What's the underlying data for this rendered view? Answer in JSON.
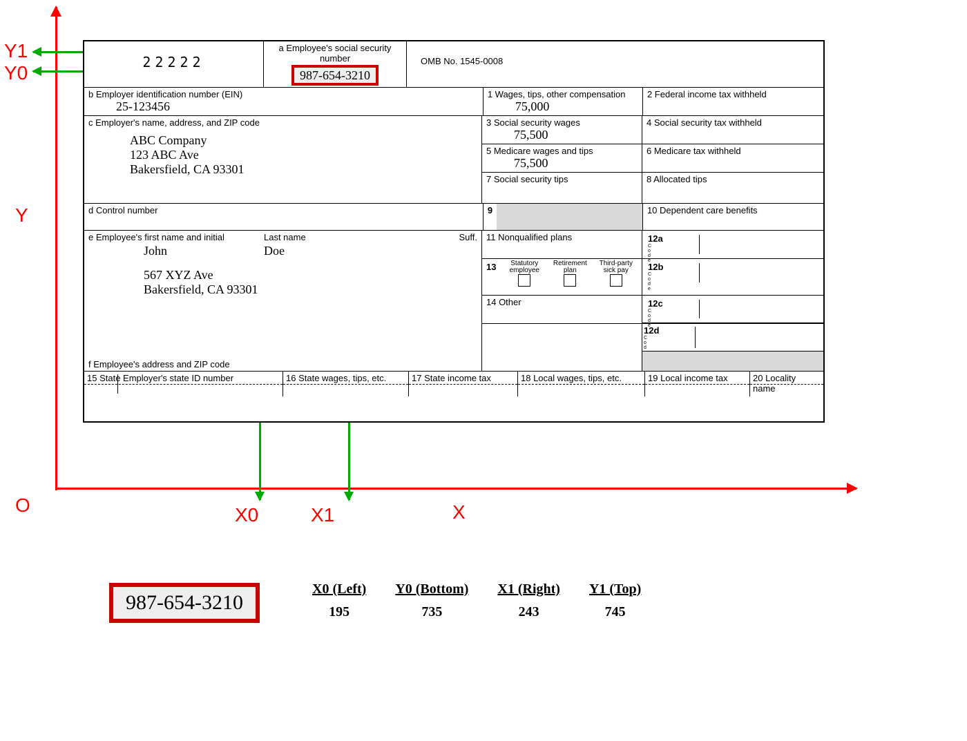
{
  "axes": {
    "O": "O",
    "X": "X",
    "Y": "Y",
    "X0": "X0",
    "X1": "X1",
    "Y0": "Y0",
    "Y1": "Y1"
  },
  "form": {
    "logoish": "22222",
    "a_label": "a  Employee's social security number",
    "a_value": "987-654-3210",
    "omb": "OMB No. 1545-0008",
    "b_label": "b  Employer identification number (EIN)",
    "b_value": "25-123456",
    "c_label": "c  Employer's name, address, and ZIP code",
    "c_name": "ABC Company",
    "c_addr1": "123 ABC Ave",
    "c_addr2": "Bakersfield, CA 93301",
    "d_label": "d  Control number",
    "e_label": "e  Employee's first name and initial",
    "e_last": "Last name",
    "e_suff": "Suff.",
    "e_first_val": "John",
    "e_last_val": "Doe",
    "e_addr1": "567 XYZ Ave",
    "e_addr2": "Bakersfield, CA 93301",
    "f_label": "f  Employee's address and ZIP code",
    "box1_l": "1   Wages, tips, other compensation",
    "box1_v": "75,000",
    "box2_l": "2   Federal income tax withheld",
    "box3_l": "3   Social security wages",
    "box3_v": "75,500",
    "box4_l": "4   Social security tax withheld",
    "box5_l": "5   Medicare wages and tips",
    "box5_v": "75,500",
    "box6_l": "6   Medicare tax withheld",
    "box7_l": "7   Social security tips",
    "box8_l": "8   Allocated tips",
    "box9_l": "9",
    "box10_l": "10   Dependent care benefits",
    "box11_l": "11   Nonqualified plans",
    "box12a": "12a",
    "box12b": "12b",
    "box12c": "12c",
    "box12d": "12d",
    "code_letters": "C\no\nd\ne",
    "box13_l": "13",
    "box13_a": "Statutory employee",
    "box13_b": "Retirement plan",
    "box13_c": "Third-party sick pay",
    "box14_l": "14  Other",
    "box15_l": "15  State    Employer's state ID number",
    "box16_l": "16  State wages, tips, etc.",
    "box17_l": "17  State income tax",
    "box18_l": "18  Local wages, tips, etc.",
    "box19_l": "19  Local income tax",
    "box20_l": "20  Locality name"
  },
  "highlight_bottom": "987-654-3210",
  "coords_table": {
    "h1": "X0 (Left)",
    "h2": "Y0 (Bottom)",
    "h3": "X1 (Right)",
    "h4": "Y1 (Top)",
    "v1": "195",
    "v2": "735",
    "v3": "243",
    "v4": "745"
  }
}
